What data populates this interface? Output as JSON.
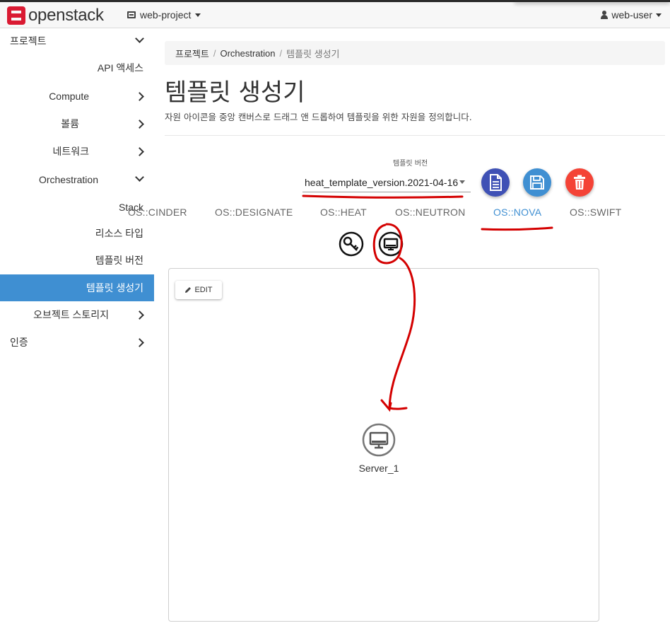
{
  "header": {
    "brand": "openstack",
    "project": "web-project",
    "user": "web-user"
  },
  "sidebar": {
    "items": [
      {
        "label": "프로젝트"
      },
      {
        "label": "API 액세스"
      },
      {
        "label": "Compute"
      },
      {
        "label": "볼륨"
      },
      {
        "label": "네트워크"
      },
      {
        "label": "Orchestration"
      },
      {
        "label": "Stack"
      },
      {
        "label": "리소스 타입"
      },
      {
        "label": "템플릿 버전"
      },
      {
        "label": "템플릿 생성기"
      },
      {
        "label": "오브젝트 스토리지"
      },
      {
        "label": "인증"
      }
    ]
  },
  "breadcrumb": {
    "items": [
      "프로젝트",
      "Orchestration",
      "템플릿 생성기"
    ]
  },
  "page": {
    "title": "템플릿 생성기",
    "description": "자원 아이콘을 중앙 캔버스로 드래그 앤 드롭하여 템플릿을 위한 자원을 정의합니다."
  },
  "version_select": {
    "label": "템플릿 버전",
    "value": "heat_template_version.2021-04-16"
  },
  "action_buttons": [
    {
      "icon": "document-icon",
      "color": "#3f51b5"
    },
    {
      "icon": "save-icon",
      "color": "#3f8fd2"
    },
    {
      "icon": "trash-icon",
      "color": "#f44336"
    }
  ],
  "tabs": [
    {
      "label": "OS::CINDER"
    },
    {
      "label": "OS::DESIGNATE"
    },
    {
      "label": "OS::HEAT"
    },
    {
      "label": "OS::NEUTRON"
    },
    {
      "label": "OS::NOVA",
      "active": true
    },
    {
      "label": "OS::SWIFT"
    }
  ],
  "resource_icons": [
    "key-icon",
    "server-icon"
  ],
  "canvas": {
    "edit_label": "EDIT",
    "nodes": [
      {
        "label": "Server_1",
        "icon": "server-icon"
      }
    ]
  },
  "colors": {
    "accent": "#3f8fd2",
    "brand_red": "#da1a32",
    "annotation_red": "#d40000"
  }
}
